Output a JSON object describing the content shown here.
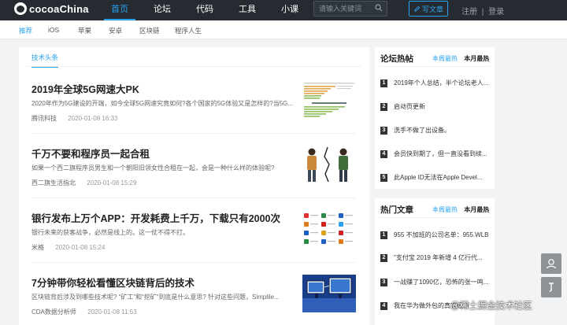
{
  "header": {
    "logo_text": "cocoaChina",
    "nav": [
      "首页",
      "论坛",
      "代码",
      "工具",
      "小课"
    ],
    "search_placeholder": "请输入关键词",
    "write_label": "写文章",
    "register": "注册",
    "separator": "|",
    "login": "登录"
  },
  "subnav": [
    "推荐",
    "iOS",
    "苹果",
    "安卓",
    "区块链",
    "程序人生"
  ],
  "main": {
    "section_tab": "技术头条",
    "articles": [
      {
        "title": "2019年全球5G网速大PK",
        "summary": "2020年作为5G建设的开端，如今全球5G网速究竟如何?各个国家的5G体验又是怎样的?当5G...",
        "author": "腾讯科技",
        "time": "2020-01-08 16:33"
      },
      {
        "title": "千万不要和程序员一起合租",
        "summary": "如果一个西二旗程序员男生和一个朝阳旧领女性合租在一起，会是一种什么样的体验呢?",
        "author": "西二旗生活指北",
        "time": "2020-01-08 15:29"
      },
      {
        "title": "银行发布上万个APP：开发耗费上千万，下载只有2000次",
        "summary": "银行未来的获客战争，必然是线上的。这一仗不得不打。",
        "author": "米格",
        "time": "2020-01-08 15:24"
      },
      {
        "title": "7分钟带你轻松看懂区块链背后的技术",
        "summary": "区块链背后涉及到哪些技术呢? “矿工”和“挖矿”到底是什么意思? 针对这些问题，Simplile...",
        "author": "CDA数据分析师",
        "time": "2020-01-08 11:53"
      }
    ]
  },
  "sidebar": {
    "hot_posts": {
      "title": "论坛热帖",
      "tab_week": "本周最热",
      "tab_month": "本月最热",
      "items": [
        {
          "rank": "1",
          "text": "2019年个人总结，半个论坛老人..."
        },
        {
          "rank": "2",
          "text": "启动页更新"
        },
        {
          "rank": "3",
          "text": "洗手不做了出设备。"
        },
        {
          "rank": "4",
          "text": "会员快到期了，但一直没看到续..."
        },
        {
          "rank": "5",
          "text": "此Apple ID无法在Apple Devel..."
        }
      ]
    },
    "hot_articles": {
      "title": "热门文章",
      "tab_week": "本周最热",
      "tab_month": "本月最热",
      "items": [
        {
          "rank": "1",
          "text": "955 不加班的公司名单：955.WLB"
        },
        {
          "rank": "2",
          "text": "\"支付宝 2019 年新增 4 亿行代..."
        },
        {
          "rank": "3",
          "text": "一战赚了1090亿，恐怖的张一鸣..."
        },
        {
          "rank": "4",
          "text": "我在华为做外包的真实经历"
        }
      ]
    }
  },
  "watermark": "@稀土掘金技术社区",
  "colors": {
    "accent": "#2aa3f0",
    "topbar": "#262b31"
  }
}
